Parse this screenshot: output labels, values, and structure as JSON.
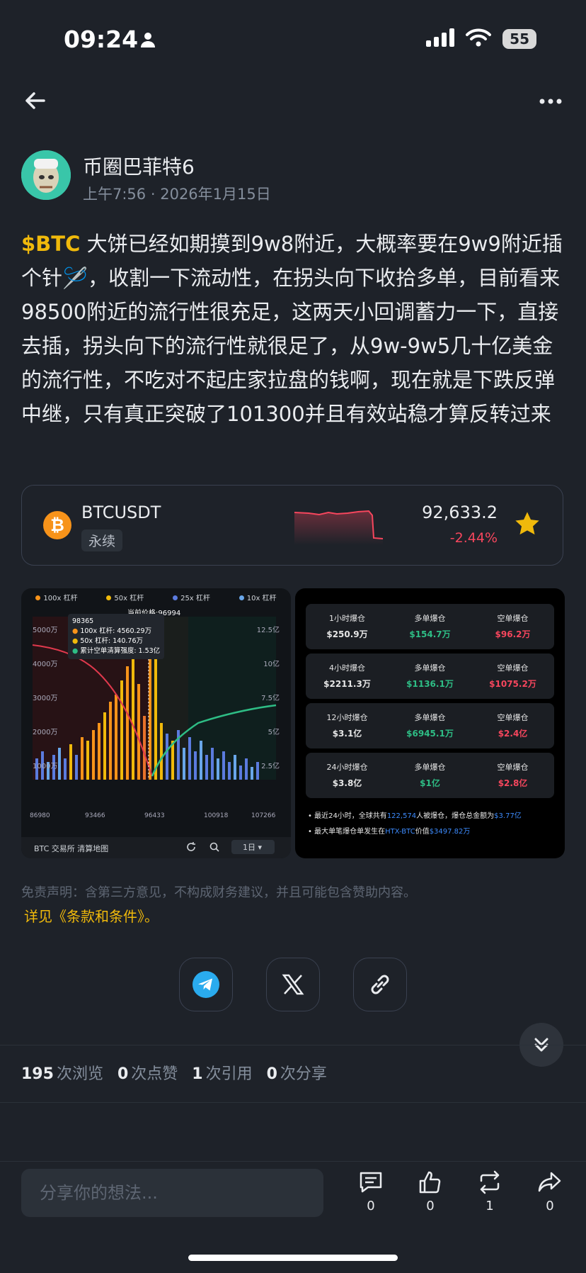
{
  "status_bar": {
    "time": "09:24",
    "battery": "55"
  },
  "post": {
    "author": "币圈巴菲特6",
    "time": "上午7:56",
    "date": "2026年1月15日",
    "cashtag": "$BTC",
    "text": " 大饼已经如期摸到9w8附近，大概率要在9w9附近插个针🪡，收割一下流动性，在拐头向下收拾多单，目前看来98500附近的流行性很充足，这两天小回调蓄力一下，直接去插，拐头向下的流行性就很足了，从9w-9w5几十亿美金的流行性，不吃对不起庄家拉盘的钱啊，现在就是下跌反弹中继，只有真正突破了101300并且有效站稳才算反转过来"
  },
  "ticker": {
    "symbol": "BTCUSDT",
    "type": "永续",
    "price": "92,633.2",
    "change": "-2.44%",
    "colors": {
      "down": "#f6465d",
      "star": "#f0b90b"
    }
  },
  "chart_left": {
    "legend": [
      "100x 杠杆",
      "50x 杠杆",
      "25x 杠杆",
      "10x 杠杆"
    ],
    "current_price": "当前价格:96994",
    "y_left": [
      "5000万",
      "4000万",
      "3000万",
      "2000万",
      "1000万"
    ],
    "y_right": [
      "12.5亿",
      "10亿",
      "7.5亿",
      "5亿",
      "2.5亿"
    ],
    "x": [
      "86980",
      "93466",
      "96433",
      "100918",
      "107266"
    ],
    "tooltip": {
      "title": "98365",
      "l1": "100x 杠杆: 4560.29万",
      "l2": "50x 杠杆: 140.76万",
      "l3": "累计空单清算强度: 1.53亿"
    },
    "footer_label": "BTC 交易所 清算地图",
    "period": "1日"
  },
  "chart_right": {
    "rows": [
      {
        "label": "1小时爆仓",
        "total": "$250.9万",
        "long_label": "多单爆仓",
        "long": "$154.7万",
        "short_label": "空单爆仓",
        "short": "$96.2万"
      },
      {
        "label": "4小时爆仓",
        "total": "$2211.3万",
        "long_label": "多单爆仓",
        "long": "$1136.1万",
        "short_label": "空单爆仓",
        "short": "$1075.2万"
      },
      {
        "label": "12小时爆仓",
        "total": "$3.1亿",
        "long_label": "多单爆仓",
        "long": "$6945.1万",
        "short_label": "空单爆仓",
        "short": "$2.4亿"
      },
      {
        "label": "24小时爆仓",
        "total": "$3.8亿",
        "long_label": "多单爆仓",
        "long": "$1亿",
        "short_label": "空单爆仓",
        "short": "$2.8亿"
      }
    ],
    "note1_a": "最近24小时，全球共有",
    "note1_b": "122,574",
    "note1_c": "人被爆仓，爆仓总金额为",
    "note1_d": "$3.77亿",
    "note2_a": "最大单笔爆仓单发生在",
    "note2_b": "HTX-BTC",
    "note2_c": "价值",
    "note2_d": "$3497.82万"
  },
  "disclaimer": "免责声明：含第三方意见，不构成财务建议，并且可能包含赞助内容。",
  "terms_link": "详见《条款和条件》。",
  "stats": {
    "views": "195",
    "views_label": "次浏览",
    "likes": "0",
    "likes_label": "次点赞",
    "quotes": "1",
    "quotes_label": "次引用",
    "shares": "0",
    "shares_label": "次分享"
  },
  "bottom_bar": {
    "placeholder": "分享你的想法...",
    "comment_count": "0",
    "like_count": "0",
    "repost_count": "1",
    "share_count": "0"
  }
}
